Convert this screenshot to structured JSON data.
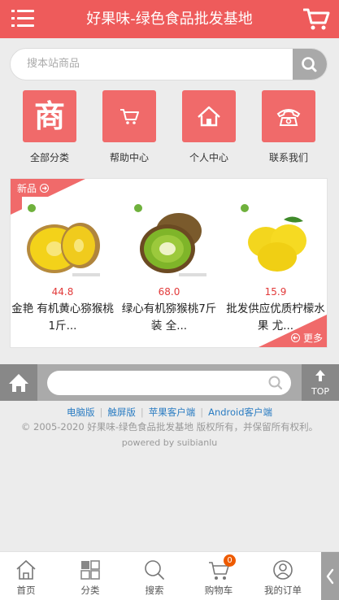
{
  "header": {
    "title": "好果味-绿色食品批发基地",
    "bg_color": "#ee5b5b",
    "menu_icon": "menu-icon",
    "cart_icon": "cart-icon"
  },
  "search": {
    "placeholder": "搜本站商品",
    "icon": "search-icon"
  },
  "quick_links": [
    {
      "label": "全部分类",
      "icon_text": "商",
      "icon": "shop-icon"
    },
    {
      "label": "帮助中心",
      "icon": "cart-icon"
    },
    {
      "label": "个人中心",
      "icon": "home-icon"
    },
    {
      "label": "联系我们",
      "icon": "phone-icon"
    }
  ],
  "new_products": {
    "tag": "新品",
    "more": "更多",
    "items": [
      {
        "price": "44.8",
        "name": "金艳 有机黄心猕猴桃1斤..."
      },
      {
        "price": "68.0",
        "name": "绿心有机猕猴桃7斤装 全..."
      },
      {
        "price": "15.9",
        "name": "批发供应优质柠檬水果 尤..."
      }
    ]
  },
  "toolbar": {
    "top_label": "TOP"
  },
  "footer": {
    "links": [
      "电脑版",
      "触屏版",
      "苹果客户端",
      "Android客户端"
    ],
    "copyright": "© 2005-2020 好果味-绿色食品批发基地 版权所有，并保留所有权利。",
    "powered": "powered by suibianlu"
  },
  "bottom_nav": [
    {
      "label": "首页",
      "icon": "home-icon"
    },
    {
      "label": "分类",
      "icon": "category-icon"
    },
    {
      "label": "搜索",
      "icon": "search-icon"
    },
    {
      "label": "购物车",
      "icon": "cart-icon",
      "badge": "0"
    },
    {
      "label": "我的订单",
      "icon": "user-icon"
    }
  ],
  "colors": {
    "accent": "#ee5b5b",
    "tile": "#f06a6a",
    "price": "#e23a3a",
    "link": "#2a7cc2"
  }
}
